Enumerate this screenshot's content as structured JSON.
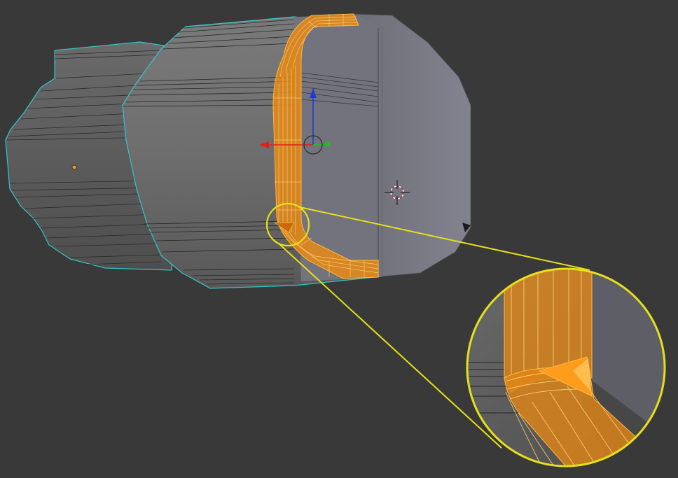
{
  "viewport": {
    "background": "#393939",
    "mesh_color": "#6b6b6b",
    "mesh_front_color": "#737373",
    "mesh_right_color": "#73737f",
    "wire_color": "#222222",
    "selection_color": "#f29a1a",
    "selection_edge_color": "#ffb840",
    "outline_color": "#33c7c7",
    "callout_color": "#e6e01a",
    "origin_dot_color": "#e89a3a"
  },
  "gizmo": {
    "x_axis_color": "#e0201a",
    "y_axis_color": "#1fbf1f",
    "z_axis_color": "#1f3ad6",
    "icon": "transform-manipulator-icon"
  },
  "cursor": {
    "icon": "3d-cursor-icon",
    "colors": [
      "#d42020",
      "#ffffff"
    ]
  },
  "zoom_callout": {
    "icon": "magnifier-callout-icon",
    "description_visible": false
  }
}
